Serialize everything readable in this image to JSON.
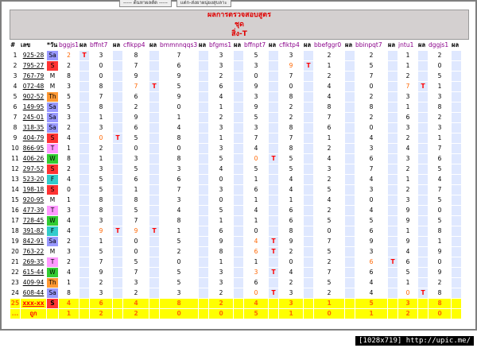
{
  "top_buttons": [
    "----- ต้นหาผลตัด -----",
    "แต่ก-ส่งยาผนุ่ยงสุบลาะ"
  ],
  "header": {
    "line1": "ผลการตรวจสอบสูตร",
    "line2": "ชุด",
    "line3": "สิ่ง-T"
  },
  "columns": [
    "#",
    "เลข",
    "*วัน",
    "bggjs1",
    "ผล",
    "bffnt7",
    "ผล",
    "cfikpp4",
    "ผล",
    "bmmnnqqs3",
    "ผล",
    "bfgms1",
    "ผล",
    "bffnpt7",
    "ผล",
    "cfiktp4",
    "ผล",
    "bbefggr0",
    "ผล",
    "bbinpqt7",
    "ผล",
    "jntu1",
    "ผล",
    "dggjs1",
    "ผล"
  ],
  "day_colors": {
    "Sa": "#9999ff",
    "S": "#ff3333",
    "M": "#ffffff",
    "T": "#ff99ff",
    "W": "#33cc33",
    "Th": "#ff9933",
    "F": "#33cccc"
  },
  "rows": [
    {
      "n": "1",
      "lot": "925-28",
      "day": "Sa",
      "v": [
        "2",
        "T",
        "3",
        "",
        "8",
        "",
        "7",
        "",
        "3",
        "",
        "5",
        "",
        "3",
        "",
        "2",
        "",
        "2",
        "",
        "1",
        "",
        "2",
        ""
      ]
    },
    {
      "n": "2",
      "lot": "795-27",
      "day": "S",
      "v": [
        "2",
        "",
        "0",
        "",
        "7",
        "",
        "6",
        "",
        "3",
        "",
        "3",
        "",
        "9",
        "T",
        "1",
        "",
        "5",
        "",
        "1",
        "",
        "0",
        ""
      ]
    },
    {
      "n": "3",
      "lot": "767-79",
      "day": "M",
      "v": [
        "8",
        "",
        "0",
        "",
        "9",
        "",
        "9",
        "",
        "2",
        "",
        "0",
        "",
        "7",
        "",
        "2",
        "",
        "7",
        "",
        "2",
        "",
        "5",
        ""
      ]
    },
    {
      "n": "4",
      "lot": "072-48",
      "day": "M",
      "v": [
        "3",
        "",
        "8",
        "",
        "7",
        "T",
        "5",
        "",
        "6",
        "",
        "9",
        "",
        "0",
        "",
        "4",
        "",
        "0",
        "",
        "7",
        "T",
        "1",
        ""
      ]
    },
    {
      "n": "5",
      "lot": "902-52",
      "day": "Th",
      "v": [
        "5",
        "",
        "7",
        "",
        "6",
        "",
        "9",
        "",
        "4",
        "",
        "3",
        "",
        "8",
        "",
        "4",
        "",
        "2",
        "",
        "3",
        "",
        "3",
        ""
      ]
    },
    {
      "n": "6",
      "lot": "149-95",
      "day": "Sa",
      "v": [
        "5",
        "",
        "8",
        "",
        "2",
        "",
        "0",
        "",
        "1",
        "",
        "9",
        "",
        "2",
        "",
        "8",
        "",
        "8",
        "",
        "1",
        "",
        "8",
        ""
      ]
    },
    {
      "n": "7",
      "lot": "245-01",
      "day": "Sa",
      "v": [
        "3",
        "",
        "1",
        "",
        "9",
        "",
        "1",
        "",
        "2",
        "",
        "5",
        "",
        "2",
        "",
        "7",
        "",
        "2",
        "",
        "6",
        "",
        "2",
        ""
      ]
    },
    {
      "n": "8",
      "lot": "318-35",
      "day": "Sa",
      "v": [
        "2",
        "",
        "3",
        "",
        "6",
        "",
        "4",
        "",
        "3",
        "",
        "3",
        "",
        "8",
        "",
        "6",
        "",
        "0",
        "",
        "3",
        "",
        "3",
        ""
      ]
    },
    {
      "n": "9",
      "lot": "404-79",
      "day": "S",
      "v": [
        "4",
        "",
        "0",
        "T",
        "5",
        "",
        "8",
        "",
        "1",
        "",
        "7",
        "",
        "7",
        "",
        "1",
        "",
        "4",
        "",
        "2",
        "",
        "1",
        ""
      ]
    },
    {
      "n": "10",
      "lot": "866-95",
      "day": "T",
      "v": [
        "1",
        "",
        "2",
        "",
        "0",
        "",
        "0",
        "",
        "3",
        "",
        "4",
        "",
        "8",
        "",
        "2",
        "",
        "3",
        "",
        "4",
        "",
        "7",
        ""
      ]
    },
    {
      "n": "11",
      "lot": "406-26",
      "day": "W",
      "v": [
        "8",
        "",
        "1",
        "",
        "3",
        "",
        "8",
        "",
        "5",
        "",
        "0",
        "T",
        "5",
        "",
        "4",
        "",
        "6",
        "",
        "3",
        "",
        "6",
        ""
      ]
    },
    {
      "n": "12",
      "lot": "297-52",
      "day": "S",
      "v": [
        "2",
        "",
        "3",
        "",
        "5",
        "",
        "3",
        "",
        "4",
        "",
        "5",
        "",
        "5",
        "",
        "3",
        "",
        "7",
        "",
        "2",
        "",
        "5",
        ""
      ]
    },
    {
      "n": "13",
      "lot": "523-20",
      "day": "F",
      "v": [
        "4",
        "",
        "5",
        "",
        "6",
        "",
        "6",
        "",
        "0",
        "",
        "1",
        "",
        "4",
        "",
        "2",
        "",
        "4",
        "",
        "1",
        "",
        "4",
        ""
      ]
    },
    {
      "n": "14",
      "lot": "198-18",
      "day": "S",
      "v": [
        "0",
        "",
        "5",
        "",
        "1",
        "",
        "7",
        "",
        "3",
        "",
        "6",
        "",
        "4",
        "",
        "5",
        "",
        "3",
        "",
        "2",
        "",
        "7",
        ""
      ]
    },
    {
      "n": "15",
      "lot": "920-95",
      "day": "M",
      "v": [
        "1",
        "",
        "8",
        "",
        "8",
        "",
        "3",
        "",
        "0",
        "",
        "1",
        "",
        "1",
        "",
        "4",
        "",
        "0",
        "",
        "3",
        "",
        "5",
        ""
      ]
    },
    {
      "n": "16",
      "lot": "477-39",
      "day": "T",
      "v": [
        "3",
        "",
        "8",
        "",
        "5",
        "",
        "4",
        "",
        "5",
        "",
        "4",
        "",
        "6",
        "",
        "2",
        "",
        "4",
        "",
        "9",
        "",
        "0",
        ""
      ]
    },
    {
      "n": "17",
      "lot": "728-45",
      "day": "W",
      "v": [
        "4",
        "",
        "3",
        "",
        "7",
        "",
        "8",
        "",
        "1",
        "",
        "1",
        "",
        "6",
        "",
        "5",
        "",
        "5",
        "",
        "9",
        "",
        "5",
        ""
      ]
    },
    {
      "n": "18",
      "lot": "391-82",
      "day": "F",
      "v": [
        "4",
        "",
        "9",
        "T",
        "9",
        "T",
        "1",
        "",
        "6",
        "",
        "0",
        "",
        "8",
        "",
        "0",
        "",
        "6",
        "",
        "1",
        "",
        "8",
        ""
      ]
    },
    {
      "n": "19",
      "lot": "842-91",
      "day": "Sa",
      "v": [
        "2",
        "",
        "1",
        "",
        "0",
        "",
        "5",
        "",
        "9",
        "",
        "4",
        "T",
        "9",
        "",
        "7",
        "",
        "9",
        "",
        "9",
        "",
        "1",
        ""
      ]
    },
    {
      "n": "20",
      "lot": "763-22",
      "day": "M",
      "v": [
        "3",
        "",
        "5",
        "",
        "0",
        "",
        "2",
        "",
        "8",
        "",
        "6",
        "T",
        "2",
        "",
        "5",
        "",
        "3",
        "",
        "4",
        "",
        "9",
        ""
      ]
    },
    {
      "n": "21",
      "lot": "269-35",
      "day": "T",
      "v": [
        "2",
        "",
        "7",
        "",
        "5",
        "",
        "0",
        "",
        "1",
        "",
        "1",
        "",
        "0",
        "",
        "2",
        "",
        "6",
        "T",
        "6",
        "",
        "0",
        ""
      ]
    },
    {
      "n": "22",
      "lot": "615-44",
      "day": "W",
      "v": [
        "4",
        "",
        "9",
        "",
        "7",
        "",
        "5",
        "",
        "3",
        "",
        "3",
        "T",
        "4",
        "",
        "7",
        "",
        "6",
        "",
        "5",
        "",
        "9",
        ""
      ]
    },
    {
      "n": "23",
      "lot": "409-94",
      "day": "Th",
      "v": [
        "1",
        "",
        "2",
        "",
        "3",
        "",
        "5",
        "",
        "3",
        "",
        "6",
        "",
        "2",
        "",
        "5",
        "",
        "4",
        "",
        "1",
        "",
        "2",
        ""
      ]
    },
    {
      "n": "24",
      "lot": "608-44",
      "day": "Sa",
      "v": [
        "8",
        "",
        "3",
        "",
        "2",
        "",
        "3",
        "",
        "2",
        "",
        "0",
        "T",
        "3",
        "",
        "2",
        "",
        "4",
        "",
        "0",
        "T",
        "8",
        ""
      ]
    }
  ],
  "hit_row": {
    "n": "25",
    "lot": "xxx-xx",
    "day": "S",
    "v": [
      "4",
      "",
      "6",
      "",
      "4",
      "",
      "8",
      "",
      "2",
      "",
      "4",
      "",
      "3",
      "",
      "1",
      "",
      "5",
      "",
      "3",
      "",
      "8",
      ""
    ]
  },
  "sum_row": {
    "n": "...",
    "label": "ถูก",
    "v": [
      "1",
      "",
      "2",
      "",
      "2",
      "",
      "0",
      "",
      "0",
      "",
      "5",
      "",
      "1",
      "",
      "0",
      "",
      "1",
      "",
      "2",
      "",
      "0",
      ""
    ]
  },
  "watermark": "[1028x719] http://upic.me/"
}
